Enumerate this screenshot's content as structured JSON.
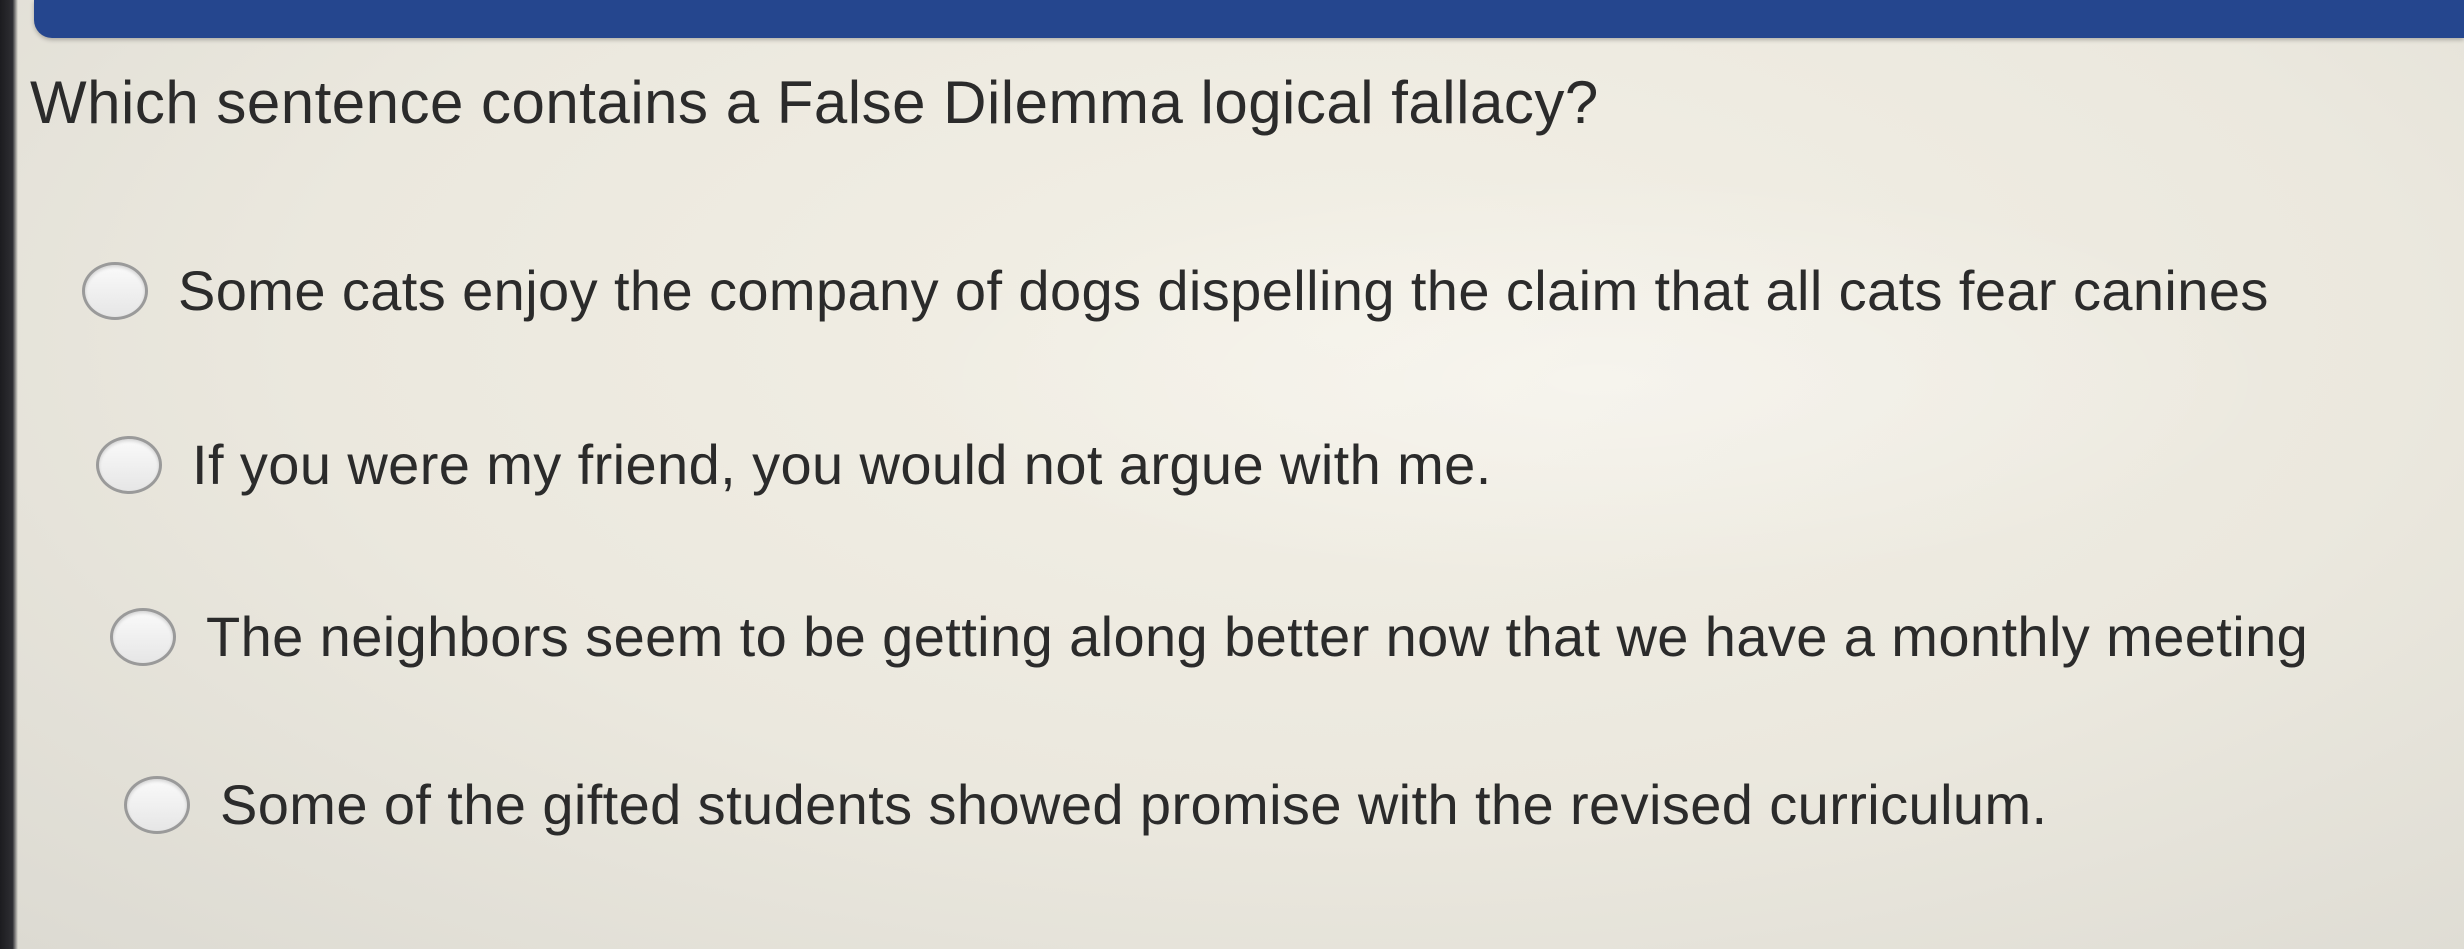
{
  "question": {
    "text": "Which sentence contains a False Dilemma logical fallacy?"
  },
  "options": [
    {
      "label": "Some cats enjoy the company of dogs dispelling the claim that all cats fear canines",
      "selected": false
    },
    {
      "label": "If you were my friend, you would not argue with me.",
      "selected": false
    },
    {
      "label": "The neighbors seem to be getting along better now that we have a monthly meeting",
      "selected": false
    },
    {
      "label": "Some of the gifted students showed promise with the revised curriculum.",
      "selected": false
    }
  ],
  "colors": {
    "header_bar": "#25468e",
    "text": "#2b2b2b"
  }
}
